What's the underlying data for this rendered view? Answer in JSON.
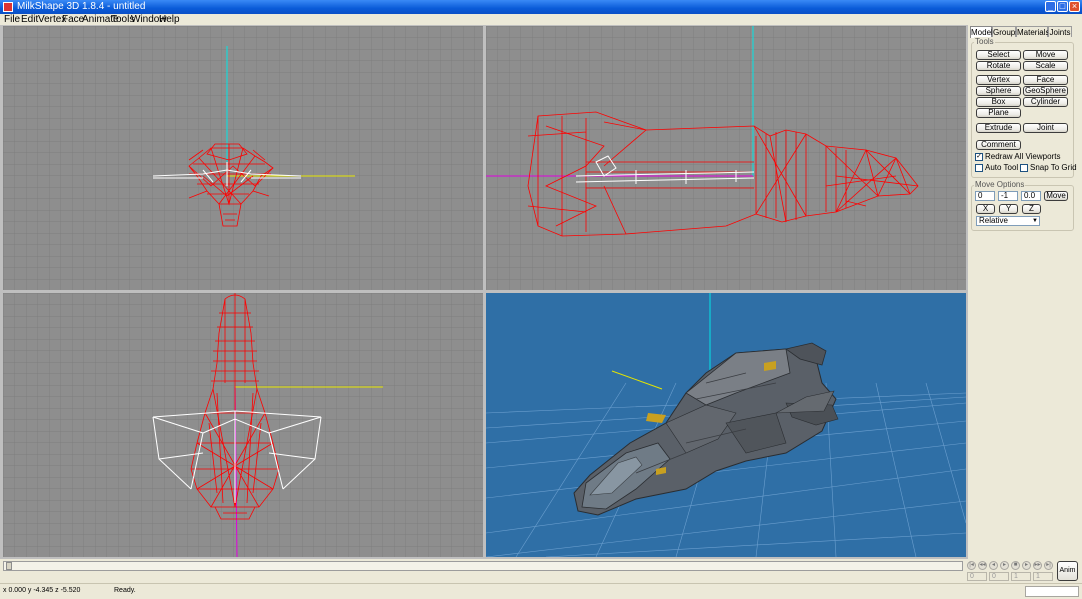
{
  "window": {
    "title": "MilkShape 3D 1.8.4 - untitled"
  },
  "menu": [
    "File",
    "Edit",
    "Vertex",
    "Face",
    "Animate",
    "Tools",
    "Window",
    "Help"
  ],
  "tabs": [
    "Model",
    "Groups",
    "Materials",
    "Joints"
  ],
  "tools": {
    "label": "Tools",
    "buttons": [
      "Select",
      "Move",
      "Rotate",
      "Scale",
      "Vertex",
      "Face",
      "Sphere",
      "GeoSphere",
      "Box",
      "Cylinder",
      "Plane",
      "Extrude",
      "Joint"
    ],
    "comment": "Comment",
    "redraw_label": "Redraw All Viewports",
    "redraw_checked": true,
    "auto_tool_label": "Auto Tool",
    "snap_label": "Snap To Grid"
  },
  "move_options": {
    "label": "Move Options",
    "x": "0",
    "y": "-1",
    "z": "0.0",
    "move_button": "Move",
    "axis_buttons": [
      "X",
      "Y",
      "Z"
    ],
    "mode": "Relative"
  },
  "animation": {
    "fields": [
      "0",
      "0",
      "1",
      "1"
    ],
    "anim_button": "Anim"
  },
  "status": {
    "coords": "x 0.000 y -4.345 z -5.520",
    "message": "Ready."
  },
  "colors": {
    "wireframe": "#ff0000",
    "grid_bg": "#8e8e8e",
    "perspective_bg": "#2f6fa6",
    "axis_cyan": "#00e5e5",
    "axis_yellow": "#e5e500",
    "axis_magenta": "#e000e0"
  },
  "icons": {
    "app": "milkshape-logo-icon",
    "minimize": "minimize-icon",
    "maximize": "maximize-icon",
    "close": "close-icon"
  }
}
